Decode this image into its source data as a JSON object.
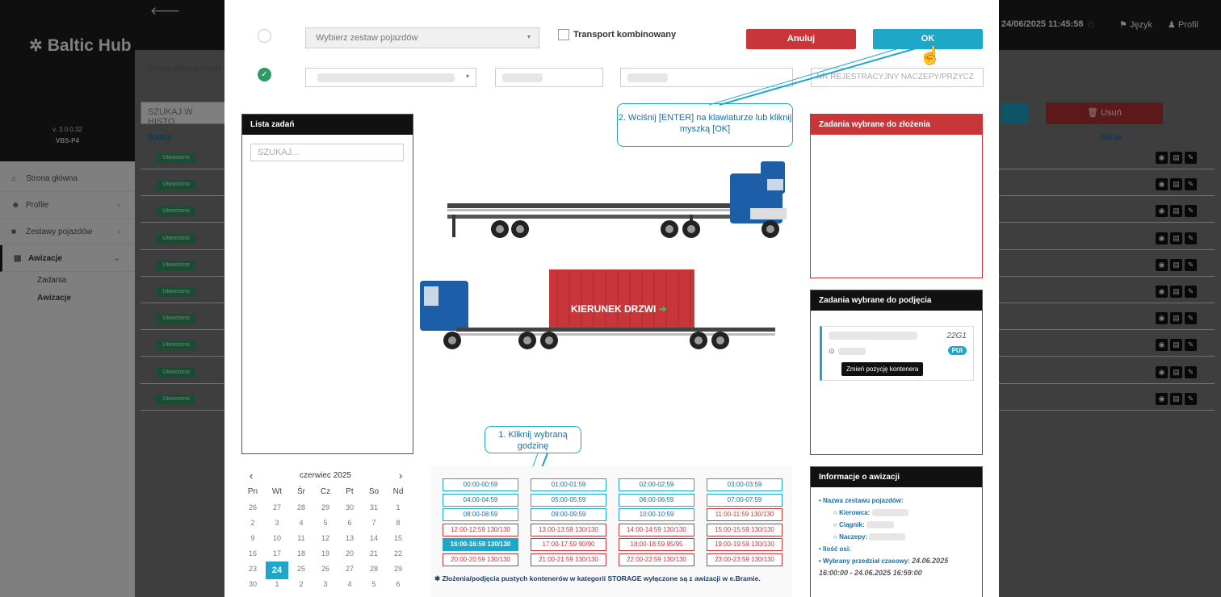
{
  "app": {
    "logo": "Baltic Hub",
    "version": "v. 3.0.0.32",
    "instance": "VBS-P4"
  },
  "topbar": {
    "datetime": "24/06/2025 11:45:58",
    "language": "Język",
    "profile": "Profil"
  },
  "sidebar": {
    "items": [
      {
        "label": "Strona główna",
        "icon": "home-icon"
      },
      {
        "label": "Profile",
        "icon": "users-icon"
      },
      {
        "label": "Zestawy pojazdów",
        "icon": "truck-icon"
      },
      {
        "label": "Awizacje",
        "icon": "calendar-icon"
      }
    ],
    "subitems": [
      "Zadania",
      "Awizacje"
    ]
  },
  "background": {
    "breadcrumb": "Strona główna / Awiz",
    "search_placeholder": "SZUKAJ W HISTO",
    "status_header": "Status",
    "actions_header": "Akcje",
    "delete_label": "Usuń",
    "badge": "Utworzono",
    "row_count": 10
  },
  "modal": {
    "vehicle_select_placeholder": "Wybierz zestaw pojazdów",
    "combined_transport": "Transport kombinowany",
    "cancel": "Anuluj",
    "ok": "OK",
    "trailer_plate_placeholder": "NR REJESTRACYJNY NACZEPY/PRZYCZ",
    "callout_enter": "2. Wciśnij [ENTER] na klawiaturze lub kliknij myszką [OK]",
    "callout_hour": "1. Kliknij wybraną godzinę",
    "tasks_panel": {
      "title": "Lista zadań",
      "search_placeholder": "SZUKAJ..."
    },
    "drop_panel": {
      "title": "Zadania wybrane do złożenia"
    },
    "pickup_panel": {
      "title": "Zadania wybrane do podjęcia",
      "iso_code": "22G1",
      "tag": "PUI",
      "tooltip": "Zmień pozycję kontenera"
    },
    "container_label": "KIERUNEK DRZWI",
    "calendar": {
      "month": "czerwiec 2025",
      "weekdays": [
        "Pn",
        "Wt",
        "Śr",
        "Cz",
        "Pt",
        "So",
        "Nd"
      ],
      "weeks": [
        [
          "26",
          "27",
          "28",
          "29",
          "30",
          "31",
          "1"
        ],
        [
          "2",
          "3",
          "4",
          "5",
          "6",
          "7",
          "8"
        ],
        [
          "9",
          "10",
          "11",
          "12",
          "13",
          "14",
          "15"
        ],
        [
          "16",
          "17",
          "18",
          "19",
          "20",
          "21",
          "22"
        ],
        [
          "23",
          "24",
          "25",
          "26",
          "27",
          "28",
          "29"
        ],
        [
          "30",
          "1",
          "2",
          "3",
          "4",
          "5",
          "6"
        ]
      ],
      "selected": "24"
    },
    "slots": [
      {
        "label": "00:00-00:59",
        "state": "free"
      },
      {
        "label": "01:00-01:59",
        "state": "free"
      },
      {
        "label": "02:00-02:59",
        "state": "free"
      },
      {
        "label": "03:00-03:59",
        "state": "free"
      },
      {
        "label": "04:00-04:59",
        "state": "free"
      },
      {
        "label": "05:00-05:59",
        "state": "free"
      },
      {
        "label": "06:00-06:59",
        "state": "free"
      },
      {
        "label": "07:00-07:59",
        "state": "free"
      },
      {
        "label": "08:00-08:59",
        "state": "free"
      },
      {
        "label": "09:00-09:59",
        "state": "free"
      },
      {
        "label": "10:00-10:59",
        "state": "free"
      },
      {
        "label": "11:00-11:59 130/130",
        "state": "full"
      },
      {
        "label": "12:00-12:59 130/130",
        "state": "full"
      },
      {
        "label": "13:00-13:59 130/130",
        "state": "full"
      },
      {
        "label": "14:00-14:59 130/130",
        "state": "full"
      },
      {
        "label": "15:00-15:59 130/130",
        "state": "full"
      },
      {
        "label": "16:00-16:59 130/130",
        "state": "selected"
      },
      {
        "label": "17:00-17:59 90/90",
        "state": "full"
      },
      {
        "label": "18:00-18:59 95/95",
        "state": "full"
      },
      {
        "label": "19:00-19:59 130/130",
        "state": "full"
      },
      {
        "label": "20:00-20:59 130/130",
        "state": "full"
      },
      {
        "label": "21:00-21:59 130/130",
        "state": "full"
      },
      {
        "label": "22:00-22:59 130/130",
        "state": "full"
      },
      {
        "label": "23:00-23:59 130/130",
        "state": "full"
      }
    ],
    "storage_note": "Złożenia/podjęcia pustych kontenerów w kategorii STORAGE wyłączone są z awizacji w e.Bramie.",
    "info_panel": {
      "title": "Informacje o awizacji",
      "vehicle_set": "Nazwa zestawu pojazdów:",
      "driver": "Kierowca:",
      "tractor": "Ciągnik:",
      "trailer": "Naczepy:",
      "axles": "Ilość osi:",
      "period_label": "Wybrany przedział czasowy:",
      "period_value": "24.06.2025 16:00:00 - 24.06.2025 16:59:00"
    }
  },
  "colors": {
    "accent": "#1ea7c9",
    "danger": "#c9363a",
    "success": "#2e9a64",
    "dark": "#111111"
  }
}
